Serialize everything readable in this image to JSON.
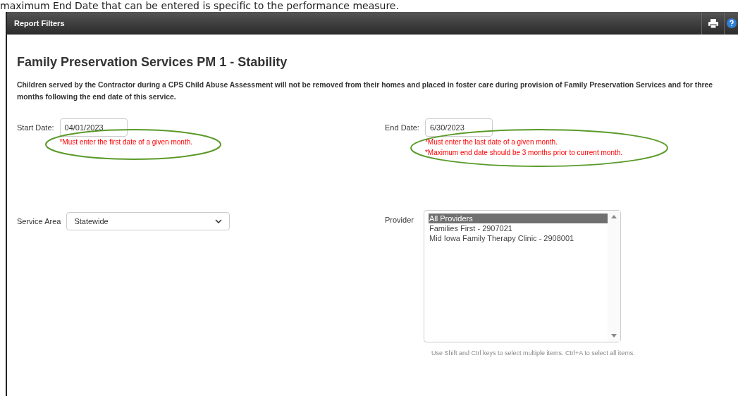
{
  "caption": "maximum End Date that can be entered is specific to the performance measure.",
  "header": {
    "title": "Report Filters"
  },
  "report": {
    "title": "Family Preservation Services PM 1 - Stability",
    "description": "Children served by the Contractor during a CPS Child Abuse Assessment will not be removed from their homes and placed in foster care during provision of Family Preservation Services and for three months following the end date of this service."
  },
  "start_date": {
    "label": "Start Date:",
    "value": "04/01/2023",
    "notes": [
      "*Must enter the first date of a given month."
    ],
    "circled": true
  },
  "end_date": {
    "label": "End Date:",
    "value": "6/30/2023",
    "notes": [
      "*Must enter the last date of a given month.",
      "*Maximum end date should be 3 months prior to current month."
    ],
    "circled": true
  },
  "service_area": {
    "label": "Service Area",
    "value": "Statewide"
  },
  "provider": {
    "label": "Provider",
    "options": [
      {
        "label": "All Providers",
        "selected": true
      },
      {
        "label": "Families First - 2907021",
        "selected": false
      },
      {
        "label": "Mid Iowa Family Therapy Clinic - 2908001",
        "selected": false
      }
    ],
    "hint": "Use Shift and Ctrl keys to select multiple items. Ctrl+A to select all items."
  }
}
